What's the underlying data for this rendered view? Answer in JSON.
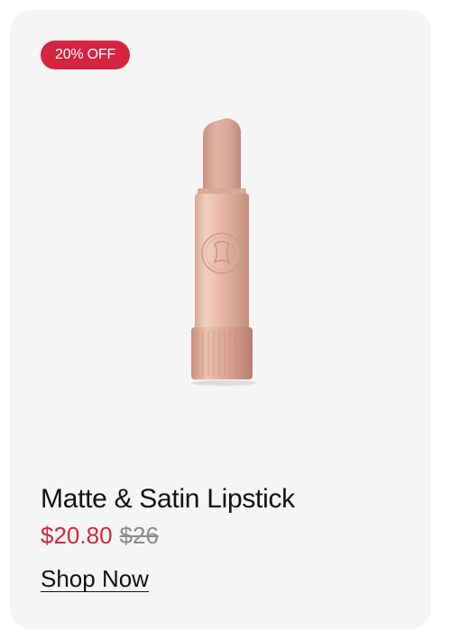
{
  "product": {
    "badge": "20% OFF",
    "image_icon": "lipstick-image",
    "title": "Matte & Satin Lipstick",
    "price_sale": "$20.80",
    "price_original": "$26",
    "cta": "Shop Now"
  },
  "colors": {
    "accent": "#d42440",
    "card_bg": "#f5f5f5",
    "lipstick_bullet": "#d9a796",
    "lipstick_tube": "#e9bca8"
  }
}
